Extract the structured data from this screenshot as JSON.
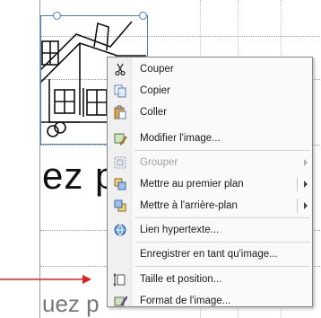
{
  "document": {
    "big_text": "ez p",
    "sub_text": "uez p"
  },
  "context_menu": {
    "items": [
      {
        "label": "Couper",
        "icon": "scissors-icon",
        "enabled": true
      },
      {
        "label": "Copier",
        "icon": "copy-icon",
        "enabled": true
      },
      {
        "label": "Coller",
        "icon": "paste-icon",
        "enabled": true
      },
      {
        "label": "Modifier l'image...",
        "icon": "edit-picture-icon",
        "enabled": true
      },
      {
        "label": "Grouper",
        "icon": "group-icon",
        "enabled": false
      },
      {
        "label": "Mettre au premier plan",
        "icon": "bring-to-front-icon",
        "enabled": true
      },
      {
        "label": "Mettre à l'arrière-plan",
        "icon": "send-to-back-icon",
        "enabled": true
      },
      {
        "label": "Lien hypertexte...",
        "icon": "hyperlink-icon",
        "enabled": true
      },
      {
        "label": "Enregistrer en tant qu'image...",
        "icon": "",
        "enabled": true
      },
      {
        "label": "Taille et position...",
        "icon": "size-position-icon",
        "enabled": true
      },
      {
        "label": "Format de l'image...",
        "icon": "format-picture-icon",
        "enabled": true
      }
    ]
  },
  "colors": {
    "arrow": "#e0201e",
    "selection": "#4a7fc1",
    "menu_border": "#868686"
  }
}
